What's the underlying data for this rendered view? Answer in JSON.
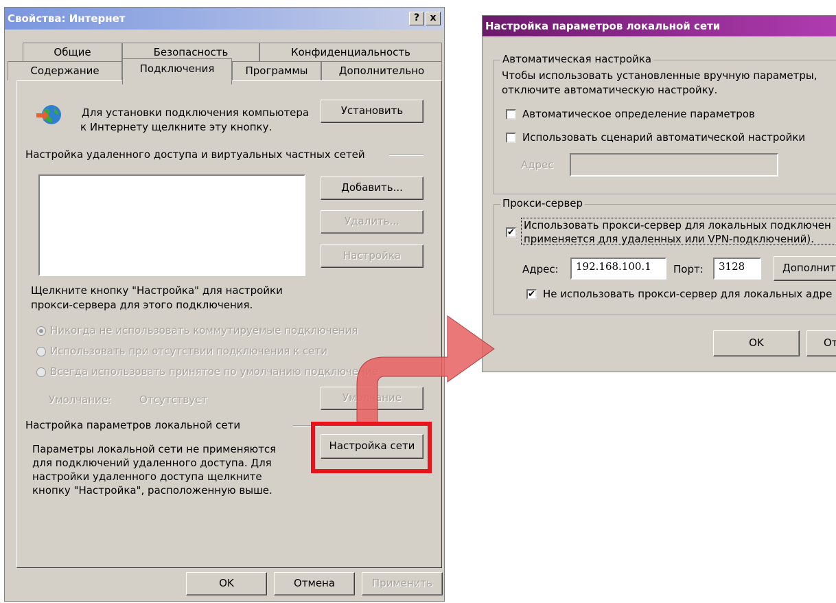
{
  "props": {
    "title": "Свойства: Интернет",
    "help_btn": "?",
    "close_btn": "x",
    "tabs_row1": [
      "Общие",
      "Безопасность",
      "Конфиденциальность"
    ],
    "tabs_row2": [
      "Содержание",
      "Подключения",
      "Программы",
      "Дополнительно"
    ],
    "setup_text_1": "Для установки подключения компьютера",
    "setup_text_2": "к Интернету щелкните эту кнопку.",
    "setup_btn": "Установить",
    "dialup_header": "Настройка удаленного доступа и виртуальных частных сетей",
    "add_btn": "Добавить...",
    "remove_btn": "Удалить...",
    "settings_btn": "Настройка",
    "proxy_hint_1": "Щелкните кнопку \"Настройка\" для настройки",
    "proxy_hint_2": "прокси-сервера для этого подключения.",
    "radios": [
      "Никогда не использовать коммутируемые подключения",
      "Использовать при отсутствии подключения к сети",
      "Всегда использовать принятое по умолчанию подключение"
    ],
    "default_label": "Умолчание:",
    "default_value": "Отсутствует",
    "default_btn": "Умолчание",
    "lan_header": "Настройка параметров локальной сети",
    "lan_text": [
      "Параметры локальной сети не применяются",
      "для подключений удаленного доступа. Для",
      "настройки удаленного доступа щелкните",
      "кнопку \"Настройка\", расположенную выше."
    ],
    "lan_btn": "Настройка сети",
    "ok_btn": "OK",
    "cancel_btn": "Отмена",
    "apply_btn": "Применить"
  },
  "lan": {
    "title": "Настройка параметров локальной сети",
    "auto_group": "Автоматическая настройка",
    "auto_text_1": "Чтобы использовать установленные вручную параметры,",
    "auto_text_2": "отключите автоматическую настройку.",
    "auto_detect": "Автоматическое определение параметров",
    "auto_script": "Использовать сценарий автоматической настройки",
    "address_label": "Адрес",
    "proxy_group": "Прокси-сервер",
    "use_proxy_1": "Использовать прокси-сервер для локальных подключен",
    "use_proxy_2": "применяется для удаленных или VPN-подключений).",
    "proxy_address_label": "Адрес:",
    "proxy_address_value": "192.168.100.1",
    "port_label": "Порт:",
    "port_value": "3128",
    "advanced_btn": "Дополните",
    "bypass_local": "Не использовать прокси-сервер для локальных адре",
    "ok_btn": "OK",
    "cancel_btn": "От"
  },
  "colors": {
    "highlight_box": "#e8141c",
    "arrow": "#e86060",
    "left_title": "#7a96df",
    "right_title_start": "#6b1a6b",
    "right_title_end": "#b03cb0"
  }
}
